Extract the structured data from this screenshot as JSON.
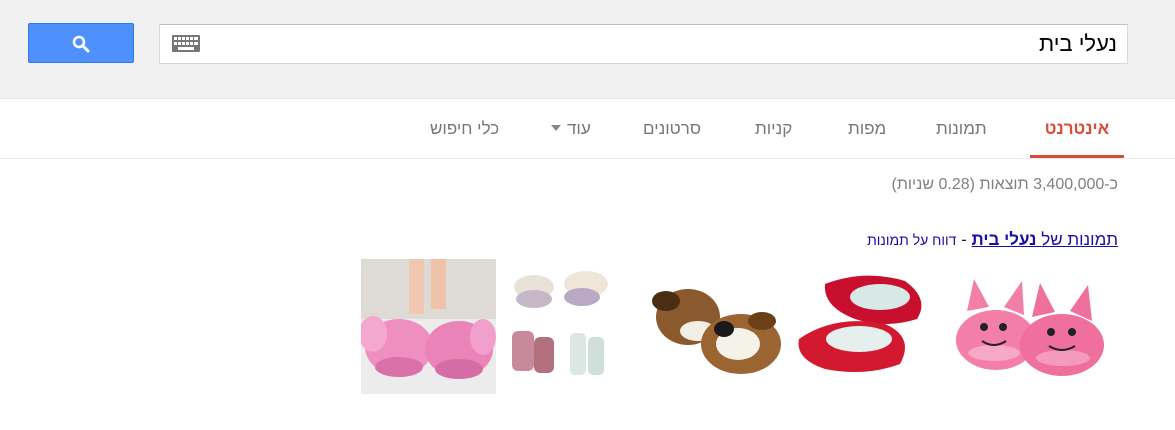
{
  "search": {
    "query": "נעלי בית",
    "button_icon": "search-icon",
    "keyboard_icon": "keyboard-icon"
  },
  "nav": {
    "tabs": [
      {
        "label": "אינטרנט",
        "active": true
      },
      {
        "label": "תמונות"
      },
      {
        "label": "מפות"
      },
      {
        "label": "קניות"
      },
      {
        "label": "סרטונים"
      },
      {
        "label": "עוד"
      },
      {
        "label": "כלי חיפוש"
      }
    ]
  },
  "results": {
    "stats": "כ-3,400,000 תוצאות (0.28 שניות)",
    "images_prefix": "תמונות של",
    "images_query": "נעלי בית",
    "separator": "-",
    "report_link": "דווח על תמונות",
    "thumbnails": [
      {
        "alt": "pink cat slippers"
      },
      {
        "alt": "red slippers"
      },
      {
        "alt": "dog slippers"
      },
      {
        "alt": "slippers collage"
      },
      {
        "alt": "pink elephant slippers"
      }
    ]
  },
  "colors": {
    "accent_red": "#dd4b39",
    "link_blue": "#1a0dab",
    "button_blue": "#4d90fe"
  }
}
